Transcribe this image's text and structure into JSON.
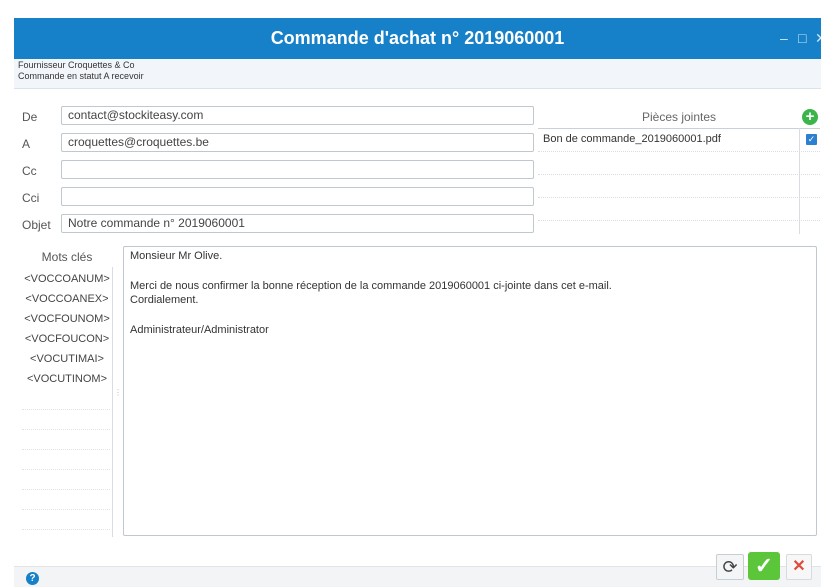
{
  "window": {
    "title": "Commande d'achat n° 2019060001",
    "minimize_glyph": "–",
    "maximize_glyph": "□",
    "close_glyph": "✕"
  },
  "info": {
    "supplier_line": "Fournisseur Croquettes & Co",
    "status_line": "Commande en statut A recevoir"
  },
  "form": {
    "from_label": "De",
    "from_value": "contact@stockiteasy.com",
    "to_label": "A",
    "to_value": "croquettes@croquettes.be",
    "cc_label": "Cc",
    "cc_value": "",
    "bcc_label": "Cci",
    "bcc_value": "",
    "subject_label": "Objet",
    "subject_value": "Notre commande n° 2019060001"
  },
  "attachments": {
    "header": "Pièces jointes",
    "add_glyph": "+",
    "items": [
      {
        "name": "Bon de commande_2019060001.pdf",
        "checked_glyph": "✓"
      }
    ]
  },
  "keywords": {
    "header": "Mots clés",
    "items": [
      "<VOCCOANUM>",
      "<VOCCOANEX>",
      "<VOCFOUNOM>",
      "<VOCFOUCON>",
      "<VOCUTIMAI>",
      "<VOCUTINOM>"
    ]
  },
  "message": {
    "lines": [
      "Monsieur Mr Olive.",
      "",
      "Merci de nous confirmer la bonne réception de la commande 2019060001 ci-jointe dans cet e-mail.",
      "Cordialement.",
      "",
      "Administrateur/Administrator"
    ]
  },
  "footer": {
    "help_glyph": "?",
    "refresh_glyph": "⟳",
    "confirm_glyph": "✓",
    "cancel_glyph": "✕"
  },
  "colors": {
    "titlebar": "#1680c8",
    "confirm": "#5cc63a",
    "cancel": "#e04a3b",
    "add": "#3bb54a"
  }
}
